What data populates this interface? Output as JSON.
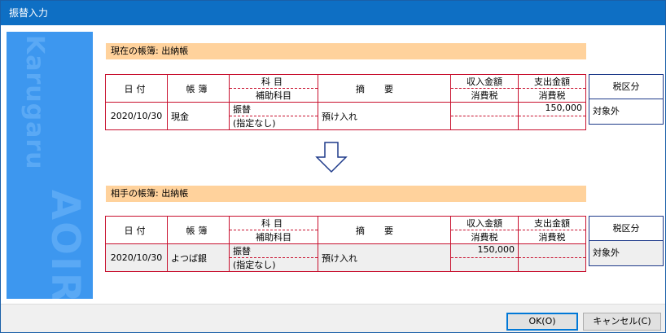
{
  "window": {
    "title": "振替入力"
  },
  "sidebar": {
    "brand_top": "Karugaru",
    "brand_bottom": "AOIRO"
  },
  "current": {
    "label": "現在の帳簿: 出納帳",
    "header": {
      "date": "日付",
      "book": "帳簿",
      "account": "科目",
      "sub_account": "補助科目",
      "summary": "摘要",
      "income": "収入金額",
      "income_tax": "消費税",
      "expense": "支出金額",
      "expense_tax": "消費税",
      "tax_class": "税区分"
    },
    "row": {
      "date": "2020/10/30",
      "book": "現金",
      "account": "振替",
      "sub_account": "(指定なし)",
      "summary": "預け入れ",
      "income": "",
      "income_tax": "",
      "expense": "150,000",
      "expense_tax": "",
      "tax_class": "対象外"
    }
  },
  "counter": {
    "label": "相手の帳簿: 出納帳",
    "header": {
      "date": "日付",
      "book": "帳簿",
      "account": "科目",
      "sub_account": "補助科目",
      "summary": "摘要",
      "income": "収入金額",
      "income_tax": "消費税",
      "expense": "支出金額",
      "expense_tax": "消費税",
      "tax_class": "税区分"
    },
    "row": {
      "date": "2020/10/30",
      "book": "よつば銀",
      "account": "振替",
      "sub_account": "(指定なし)",
      "summary": "預け入れ",
      "income": "150,000",
      "income_tax": "",
      "expense": "",
      "expense_tax": "",
      "tax_class": "対象外"
    }
  },
  "buttons": {
    "ok": "OK(O)",
    "cancel": "キャンセル(C)"
  },
  "colors": {
    "title_bar": "#0e6fc4",
    "sidebar": "#3d97ef",
    "section_head": "#ffd29c",
    "grid_border": "#c8102e",
    "tax_border": "#1e3a8a"
  }
}
